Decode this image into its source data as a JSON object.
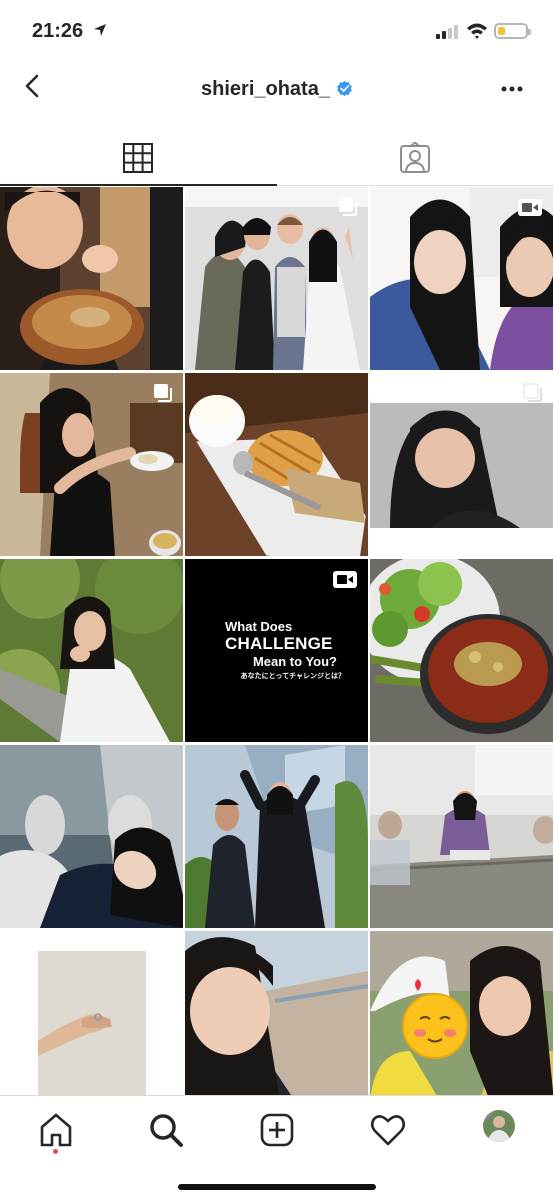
{
  "status_bar": {
    "time": "21:26"
  },
  "header": {
    "username": "shieri_ohata_"
  },
  "tabs": [
    {
      "name": "grid",
      "active": true
    },
    {
      "name": "tagged",
      "active": false
    }
  ],
  "video_post_text": {
    "line1": "What Does",
    "line2": "CHALLENGE",
    "line3": "Mean to You?",
    "line4": "あなたにとってチャレンジとは？"
  },
  "icons": {
    "status": [
      "location-arrow-icon",
      "signal-icon",
      "wifi-icon",
      "battery-icon"
    ],
    "header": [
      "back-chevron-icon",
      "verified-badge-icon",
      "more-options-icon"
    ],
    "tabs": [
      "grid-icon",
      "tagged-person-icon"
    ],
    "post_badges": [
      "multiple-posts-icon",
      "igtv-video-icon"
    ],
    "nav": [
      "home-icon",
      "search-icon",
      "new-post-icon",
      "activity-heart-icon",
      "profile-avatar"
    ]
  },
  "colors": {
    "verified": "#3897f0",
    "notification_dot": "#ed4956",
    "battery": "#f3c335"
  }
}
